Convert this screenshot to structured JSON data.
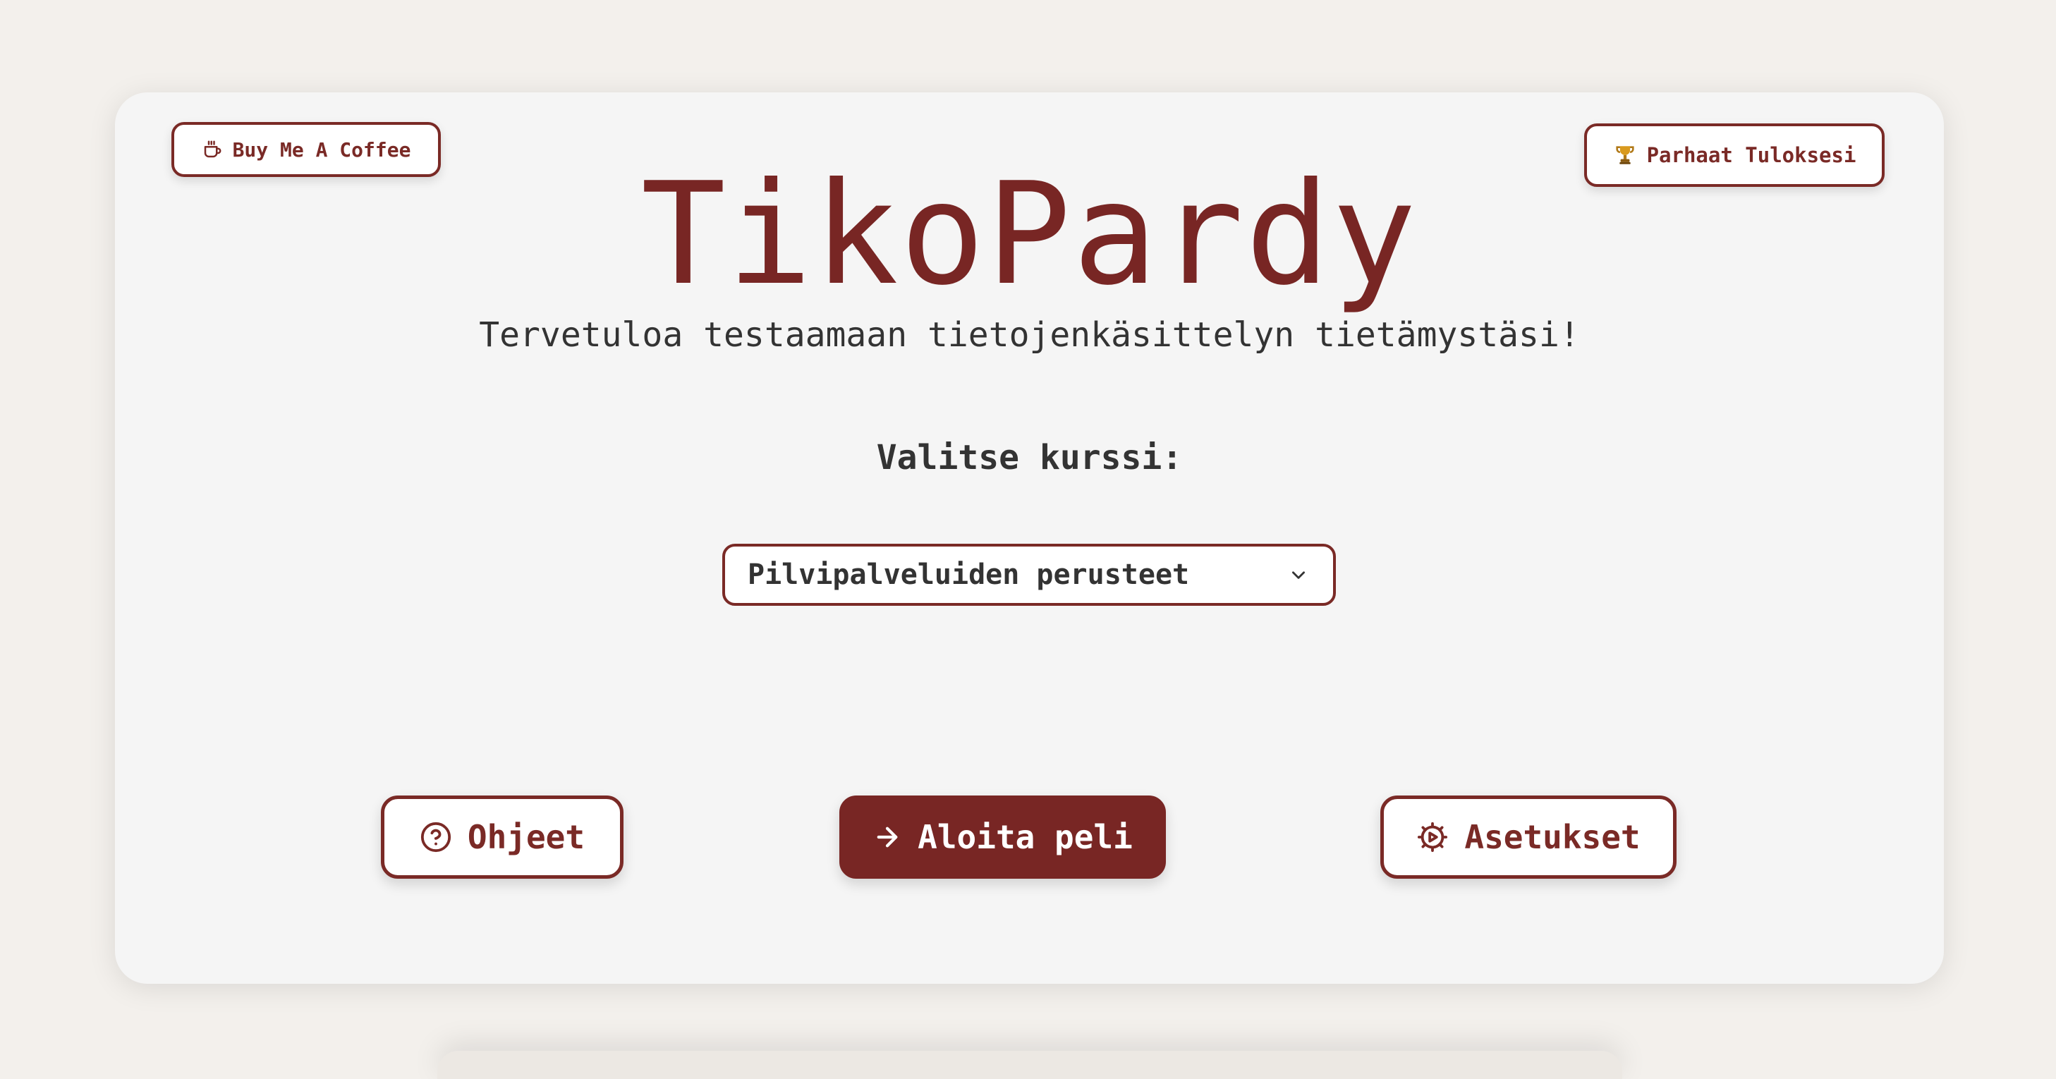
{
  "header": {
    "coffee_label": "Buy Me A Coffee",
    "coffee_icon": "coffee-cup-icon",
    "scores_label": "Parhaat Tuloksesi",
    "scores_icon": "trophy-icon"
  },
  "hero": {
    "title": "TikoPardy",
    "subtitle": "Tervetuloa testaamaan tietojenkäsittelyn tietämystäsi!"
  },
  "course": {
    "label": "Valitse kurssi:",
    "selected": "Pilvipalveluiden perusteet"
  },
  "actions": {
    "help_label": "Ohjeet",
    "help_icon": "question-circle-icon",
    "start_label": "Aloita peli",
    "start_icon": "arrow-right-icon",
    "settings_label": "Asetukset",
    "settings_icon": "gear-icon"
  },
  "colors": {
    "accent": "#782624",
    "background": "#f3f0ec",
    "card": "#f5f5f5",
    "text": "#333333"
  }
}
